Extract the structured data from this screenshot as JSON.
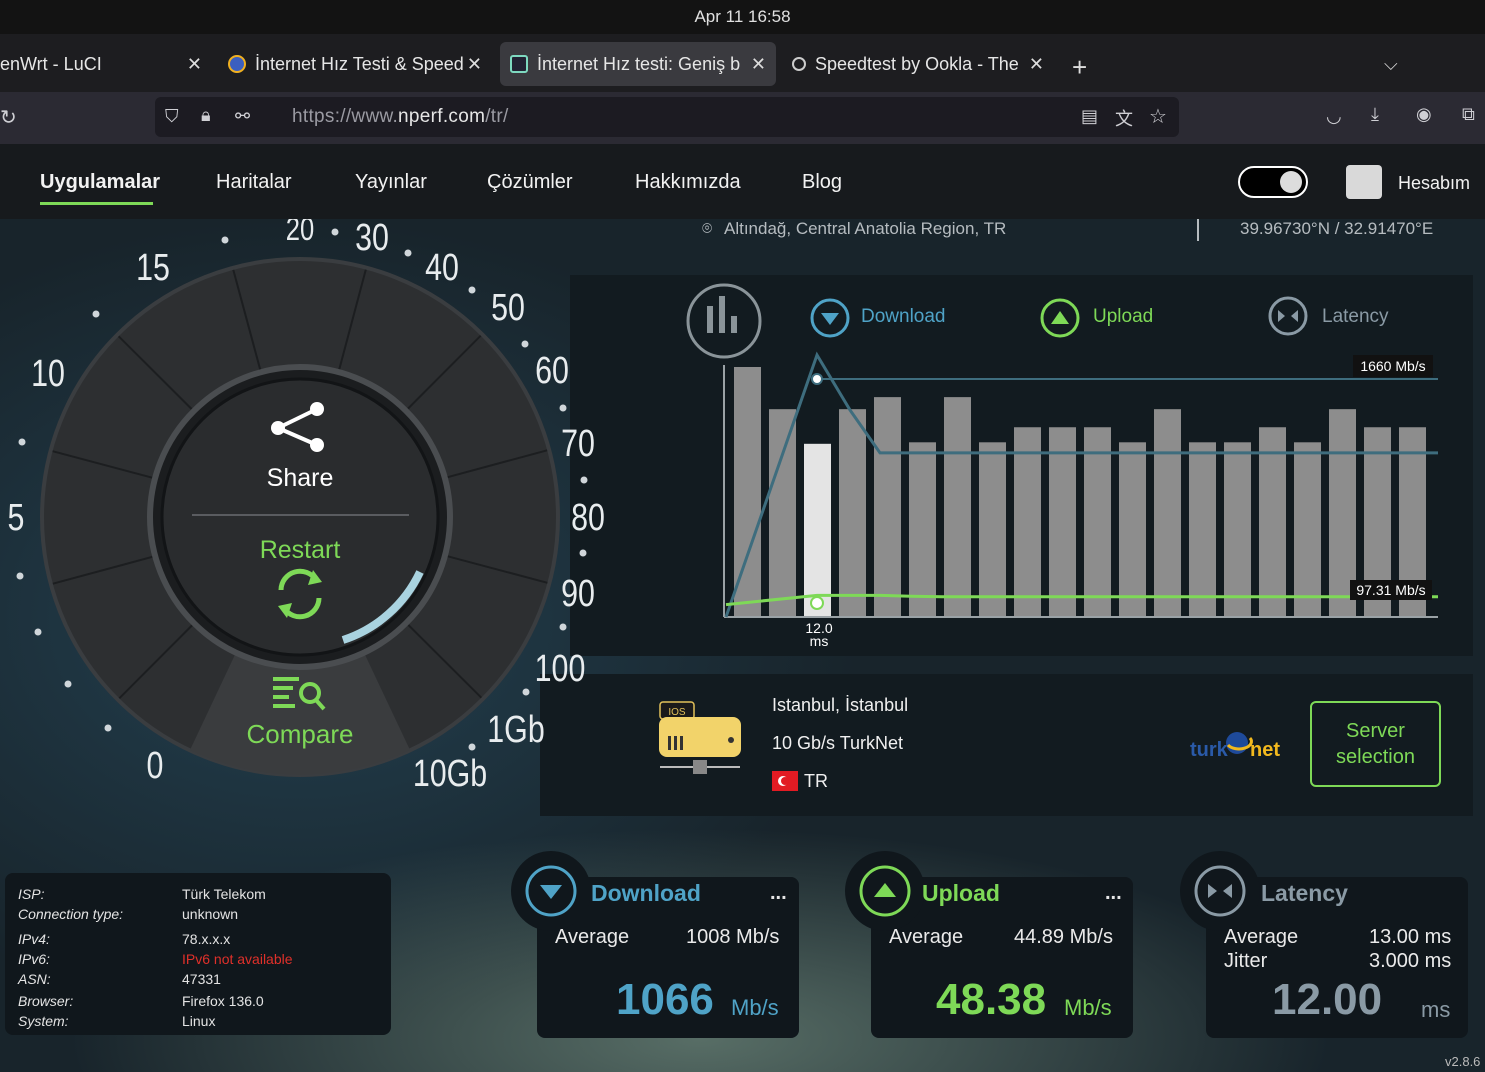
{
  "os": {
    "clock": "Apr 11  16:58"
  },
  "tabs": [
    {
      "title": "enWrt - LuCI"
    },
    {
      "title": "İnternet Hız Testi & Speed"
    },
    {
      "title": "İnternet Hız testi: Geniş b"
    },
    {
      "title": "Speedtest by Ookla - The"
    }
  ],
  "address": {
    "prefix": "https://www.",
    "domain": "nperf.com",
    "path": "/tr/"
  },
  "nav": {
    "items": [
      "Uygulamalar",
      "Haritalar",
      "Yayınlar",
      "Çözümler",
      "Hakkımızda",
      "Blog"
    ],
    "account": "Hesabım"
  },
  "location": {
    "place": "Altındağ, Central Anatolia Region, TR",
    "coords": "39.96730°N / 32.91470°E"
  },
  "gauge": {
    "ticks": [
      "0",
      "5",
      "10",
      "15",
      "20",
      "30",
      "40",
      "50",
      "60",
      "70",
      "80",
      "90",
      "100",
      "1Gb",
      "10Gb"
    ],
    "share_label": "Share",
    "restart_label": "Restart",
    "compare_label": "Compare"
  },
  "graph": {
    "legend": {
      "download": "Download",
      "upload": "Upload",
      "latency": "Latency"
    },
    "max_label": "1660 Mb/s",
    "upload_label": "97.31 Mb/s",
    "latency_value": "12.0",
    "latency_unit": "ms"
  },
  "chart_data": {
    "type": "bar",
    "values": [
      1660,
      1380,
      1150,
      1380,
      1460,
      1160,
      1460,
      1160,
      1260,
      1260,
      1260,
      1160,
      1380,
      1160,
      1160,
      1260,
      1160,
      1380,
      1260,
      1260
    ],
    "download_line": [
      0,
      1660,
      1010,
      1010,
      1010,
      1010,
      1010,
      1010,
      1010,
      1010,
      1010,
      1010,
      1010,
      1010,
      1010,
      1010,
      1010,
      1010,
      1010,
      1010,
      1010
    ],
    "upload_line": [
      20,
      97,
      97,
      90,
      85,
      85,
      85,
      85,
      85,
      85,
      85,
      85,
      85,
      85,
      85,
      85,
      85,
      85,
      85,
      85,
      85
    ],
    "ylim": [
      0,
      1660
    ]
  },
  "server": {
    "city": "Istanbul, İstanbul",
    "provider": "10 Gb/s TurkNet",
    "country": "TR",
    "ios_badge": "IOS",
    "logo_text_1": "turk",
    "logo_text_2": "net",
    "button": "Server selection"
  },
  "info": {
    "rows": [
      {
        "k": "ISP:",
        "v": "Türk Telekom"
      },
      {
        "k": "Connection type:",
        "v": "unknown"
      },
      {
        "k": "IPv4:",
        "v": "78.x.x.x"
      },
      {
        "k": "IPv6:",
        "v": "IPv6 not available"
      },
      {
        "k": "ASN:",
        "v": "47331"
      },
      {
        "k": "Browser:",
        "v": "Firefox 136.0"
      },
      {
        "k": "System:",
        "v": "Linux"
      }
    ]
  },
  "results": {
    "download": {
      "title": "Download",
      "avg_label": "Average",
      "avg_value": "1008 Mb/s",
      "big": "1066",
      "unit": "Mb/s",
      "dots": "..."
    },
    "upload": {
      "title": "Upload",
      "avg_label": "Average",
      "avg_value": "44.89 Mb/s",
      "big": "48.38",
      "unit": "Mb/s",
      "dots": "..."
    },
    "latency": {
      "title": "Latency",
      "avg_label": "Average",
      "avg_value": "13.00 ms",
      "jitter_label": "Jitter",
      "jitter_value": "3.000 ms",
      "big": "12.00",
      "unit": "ms"
    }
  },
  "colors": {
    "accent_green": "#7ed957",
    "download_blue": "#4fa3c7",
    "latency_gray": "#8a9aa5"
  },
  "version": "v2.8.6"
}
